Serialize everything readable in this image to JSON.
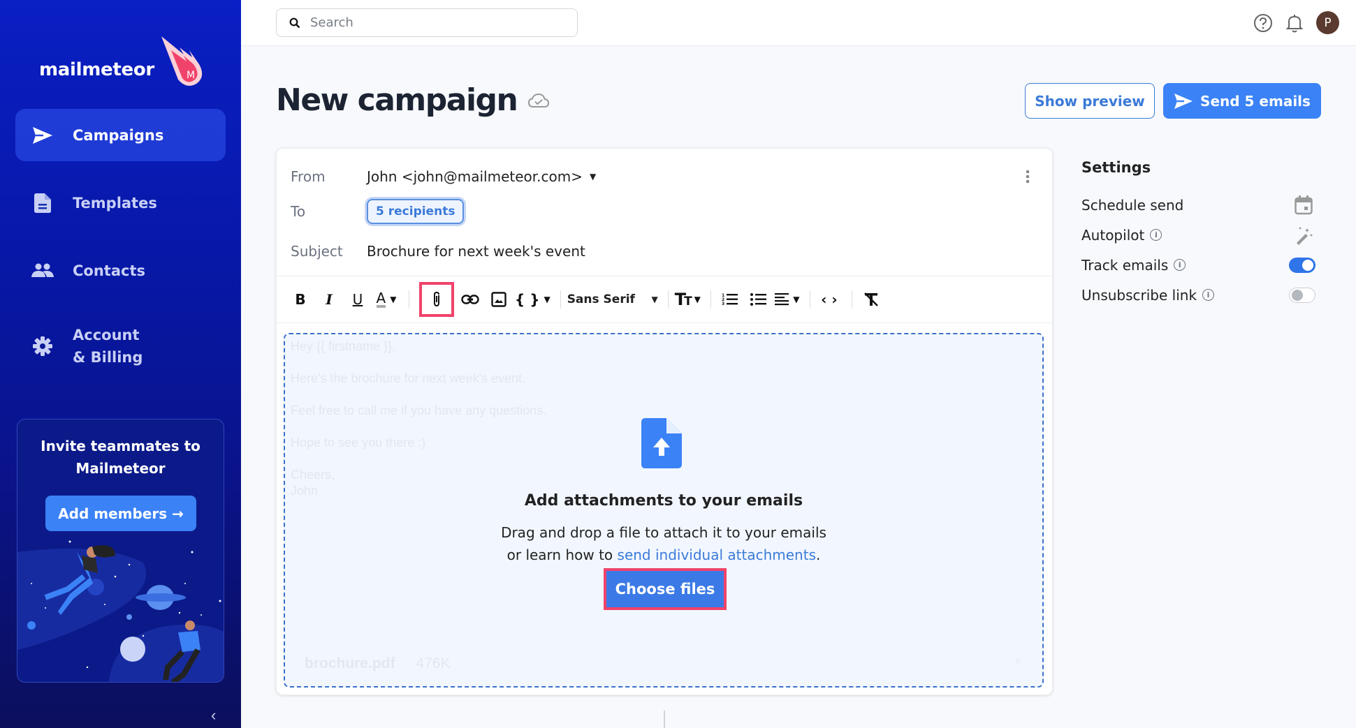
{
  "app": {
    "name": "mailmeteor"
  },
  "sidebar": {
    "items": [
      {
        "label": "Campaigns",
        "icon": "send-icon",
        "active": true
      },
      {
        "label": "Templates",
        "icon": "document-icon",
        "active": false
      },
      {
        "label": "Contacts",
        "icon": "people-icon",
        "active": false
      },
      {
        "label": "Account\n& Billing",
        "label_line1": "Account",
        "label_line2": "& Billing",
        "icon": "gear-icon",
        "active": false
      }
    ],
    "invite": {
      "title_line1": "Invite teammates to",
      "title_line2": "Mailmeteor",
      "button": "Add members →"
    },
    "collapse_icon": "chevron-left-icon"
  },
  "topbar": {
    "search_placeholder": "Search",
    "avatar_initial": "P",
    "icons": [
      "help-icon",
      "bell-icon"
    ]
  },
  "header": {
    "title": "New campaign",
    "save_status_icon": "cloud-check-icon",
    "show_preview": "Show preview",
    "send": "Send 5 emails"
  },
  "composer": {
    "from_label": "From",
    "from_value": "John <john@mailmeteor.com>",
    "to_label": "To",
    "to_value": "5 recipients",
    "subject_label": "Subject",
    "subject_value": "Brochure for next week's event",
    "toolbar": {
      "font": "Sans Serif",
      "buttons": [
        "bold",
        "italic",
        "underline",
        "text-color",
        "attachment",
        "link",
        "image",
        "variables",
        "font-family",
        "text-size",
        "numbered-list",
        "bulleted-list",
        "align",
        "code",
        "clear-formatting"
      ],
      "highlighted": "attachment"
    },
    "body_lines": [
      "Hey {{ firstname }},",
      "Here's the brochure for next week's event.",
      "Feel free to call me if you have any questions.",
      "Hope to see you there :)",
      "Cheers,",
      "John"
    ],
    "attachment": {
      "name": "brochure.pdf",
      "size": "476K"
    },
    "dropzone": {
      "title": "Add attachments to your emails",
      "text_line1": "Drag and drop a file to attach it to your emails",
      "text_line2_prefix": "or learn how to ",
      "link": "send individual attachments",
      "text_line2_suffix": ".",
      "button": "Choose files"
    }
  },
  "settings": {
    "title": "Settings",
    "rows": [
      {
        "label": "Schedule send",
        "info": false,
        "control": "calendar-icon"
      },
      {
        "label": "Autopilot",
        "info": true,
        "control": "magic-wand-icon"
      },
      {
        "label": "Track emails",
        "info": true,
        "control": "toggle",
        "enabled": true
      },
      {
        "label": "Unsubscribe link",
        "info": true,
        "control": "toggle",
        "enabled": false
      }
    ]
  },
  "colors": {
    "primary": "#3b82f6",
    "highlight": "#f0436b",
    "sidebar_top": "#0a1fc4",
    "sidebar_bottom": "#0b0f5c"
  }
}
